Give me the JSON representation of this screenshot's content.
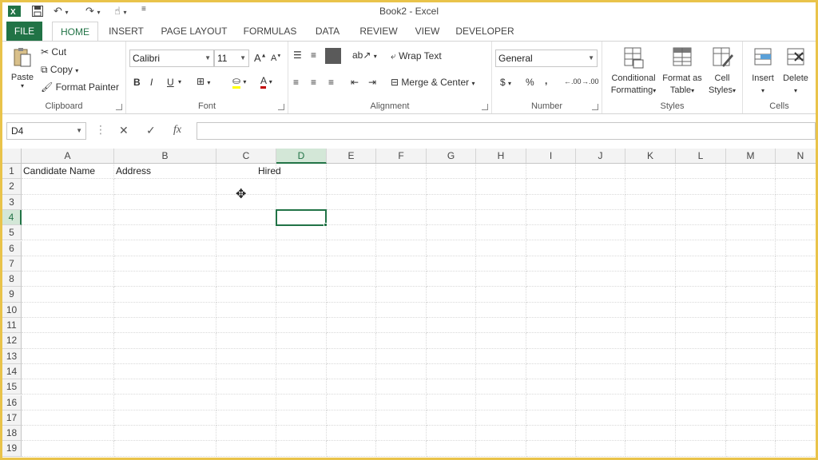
{
  "window": {
    "title": "Book2 - Excel"
  },
  "qat": {
    "app_icon": "excel-icon",
    "save_icon": "save-icon",
    "undo_icon": "undo-icon",
    "redo_icon": "redo-icon",
    "touch_icon": "touch-mode-icon",
    "customize_icon": "customize-icon"
  },
  "tabs": [
    "FILE",
    "HOME",
    "INSERT",
    "PAGE LAYOUT",
    "FORMULAS",
    "DATA",
    "REVIEW",
    "VIEW",
    "DEVELOPER"
  ],
  "ribbon": {
    "clipboard": {
      "label": "Clipboard",
      "paste": "Paste",
      "cut": "Cut",
      "copy": "Copy",
      "format_painter": "Format Painter"
    },
    "font": {
      "label": "Font",
      "font_name": "Calibri",
      "font_size": "11",
      "bold": "B",
      "italic": "I",
      "underline": "U"
    },
    "alignment": {
      "label": "Alignment",
      "wrap_text": "Wrap Text",
      "merge_center": "Merge & Center"
    },
    "number": {
      "label": "Number",
      "format": "General",
      "currency": "$",
      "percent": "%",
      "comma": ",",
      "inc_dec": ".00",
      "dec_dec": ".00"
    },
    "styles": {
      "label": "Styles",
      "conditional_1": "Conditional",
      "conditional_2": "Formatting",
      "format_table_1": "Format as",
      "format_table_2": "Table",
      "cell_styles_1": "Cell",
      "cell_styles_2": "Styles"
    },
    "cells": {
      "label": "Cells",
      "insert": "Insert",
      "delete": "Delete"
    }
  },
  "formula_bar": {
    "name_box": "D4",
    "fx": "fx",
    "cancel": "✕",
    "enter": "✓",
    "value": ""
  },
  "grid": {
    "columns": [
      "A",
      "B",
      "C",
      "D",
      "E",
      "F",
      "G",
      "H",
      "I",
      "J",
      "K",
      "L",
      "M",
      "N"
    ],
    "rows": [
      "1",
      "2",
      "3",
      "4",
      "5",
      "6",
      "7",
      "8",
      "9",
      "10",
      "11",
      "12",
      "13",
      "14",
      "15",
      "16",
      "17",
      "18",
      "19"
    ],
    "selected_column": "D",
    "selected_row": "4",
    "cells": {
      "A1": "Candidate Name",
      "B1": "Address",
      "C1": "Hired"
    },
    "accent": "#217346"
  }
}
